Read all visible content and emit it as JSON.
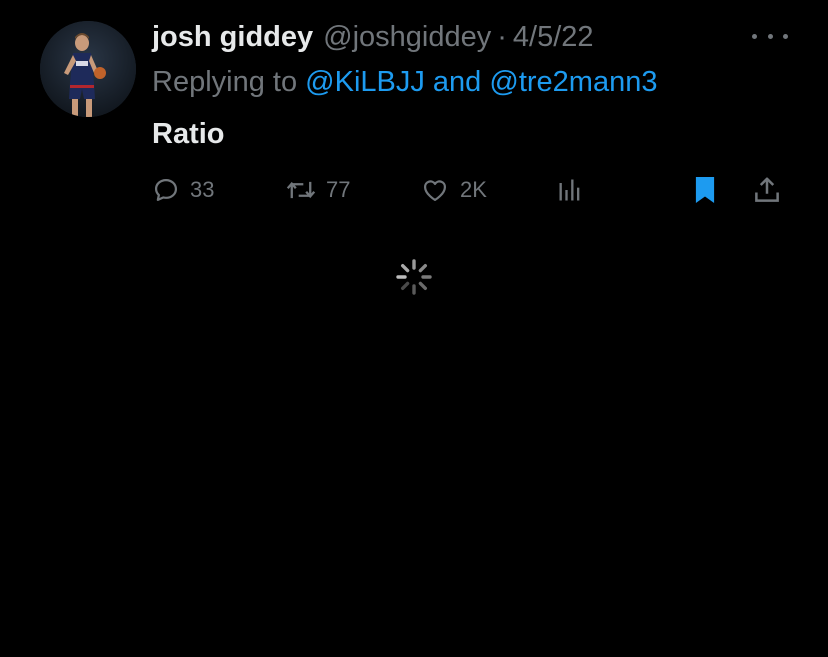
{
  "tweet": {
    "author_name": "josh giddey",
    "handle": "@joshgiddey",
    "separator": "·",
    "date": "4/5/22",
    "reply_prefix": "Replying to",
    "mention_1": "@KiLBJJ",
    "mention_joiner": "and",
    "mention_2": "@tre2mann3",
    "text": "Ratio"
  },
  "actions": {
    "replies": "33",
    "retweets": "77",
    "likes": "2K",
    "views_icon": "bar-chart-icon",
    "bookmark_icon": "bookmark-icon",
    "share_icon": "share-icon"
  },
  "colors": {
    "background": "#000000",
    "text_primary": "#e7e9ea",
    "text_secondary": "#71767b",
    "accent": "#1d9bf0"
  }
}
